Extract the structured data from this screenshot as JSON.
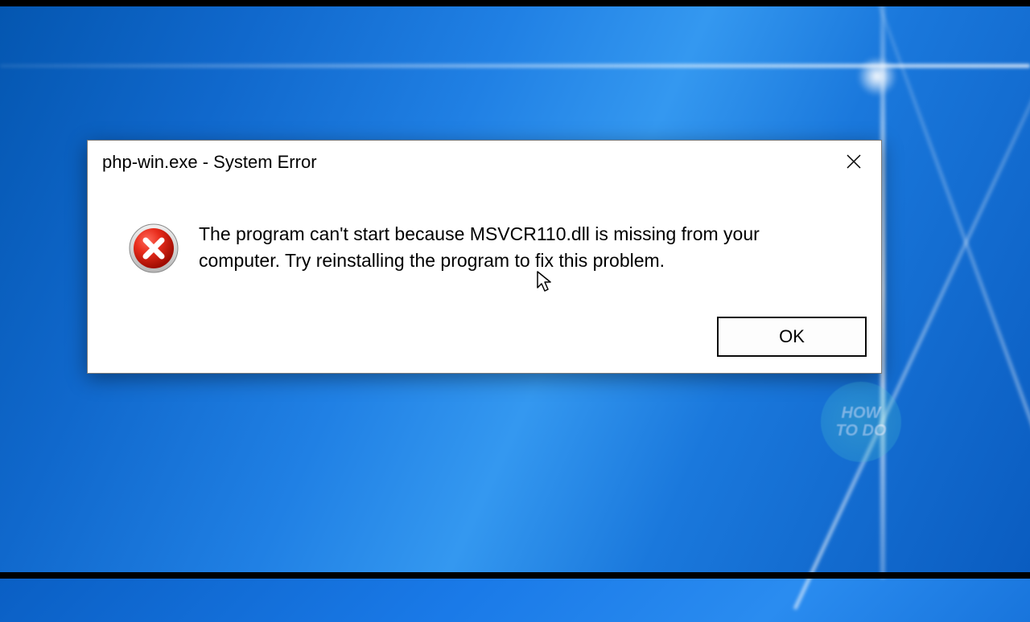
{
  "dialog": {
    "title": "php-win.exe - System Error",
    "message": "The program can't start because MSVCR110.dll is missing from your computer. Try reinstalling the program to fix this problem.",
    "ok_label": "OK"
  },
  "watermark": {
    "line1": "HOW",
    "line2": "TO DO"
  }
}
